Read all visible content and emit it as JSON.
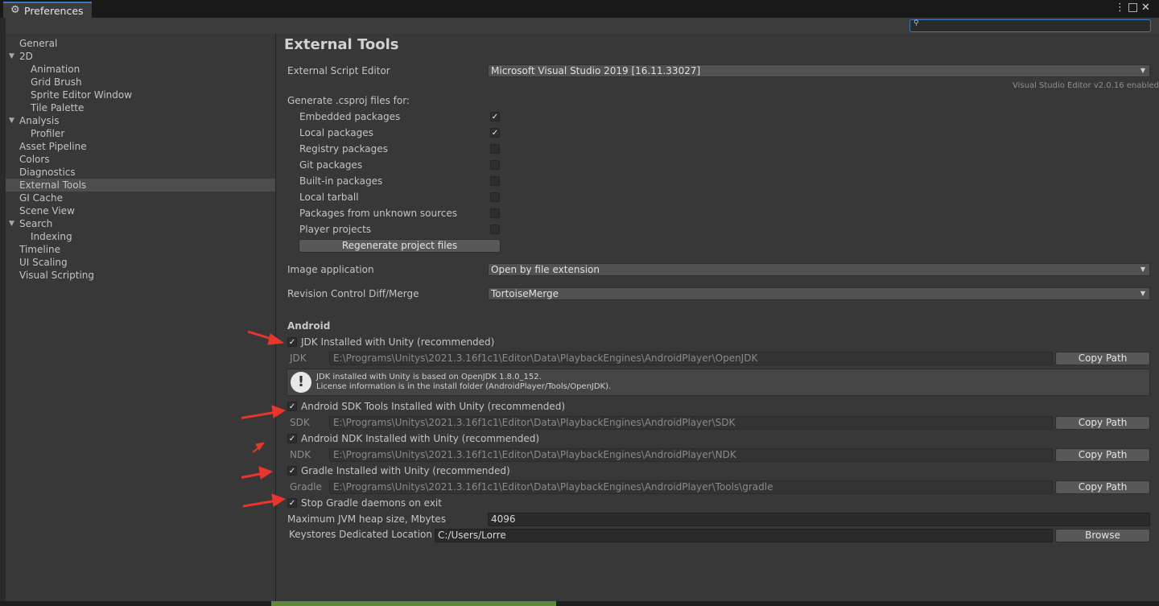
{
  "window": {
    "tab_title": "Preferences",
    "gear_icon": "gear-icon",
    "menu_icon": "⋮",
    "maximize_icon": "□",
    "close_icon": "✕"
  },
  "search": {
    "placeholder": "",
    "value": ""
  },
  "sidebar": {
    "items": [
      {
        "label": "General",
        "level": 0,
        "expanded": null,
        "selected": false
      },
      {
        "label": "2D",
        "level": 0,
        "expanded": true,
        "selected": false
      },
      {
        "label": "Animation",
        "level": 1,
        "expanded": null,
        "selected": false
      },
      {
        "label": "Grid Brush",
        "level": 1,
        "expanded": null,
        "selected": false
      },
      {
        "label": "Sprite Editor Window",
        "level": 1,
        "expanded": null,
        "selected": false
      },
      {
        "label": "Tile Palette",
        "level": 1,
        "expanded": null,
        "selected": false
      },
      {
        "label": "Analysis",
        "level": 0,
        "expanded": true,
        "selected": false
      },
      {
        "label": "Profiler",
        "level": 1,
        "expanded": null,
        "selected": false
      },
      {
        "label": "Asset Pipeline",
        "level": 0,
        "expanded": null,
        "selected": false
      },
      {
        "label": "Colors",
        "level": 0,
        "expanded": null,
        "selected": false
      },
      {
        "label": "Diagnostics",
        "level": 0,
        "expanded": null,
        "selected": false
      },
      {
        "label": "External Tools",
        "level": 0,
        "expanded": null,
        "selected": true
      },
      {
        "label": "GI Cache",
        "level": 0,
        "expanded": null,
        "selected": false
      },
      {
        "label": "Scene View",
        "level": 0,
        "expanded": null,
        "selected": false
      },
      {
        "label": "Search",
        "level": 0,
        "expanded": true,
        "selected": false
      },
      {
        "label": "Indexing",
        "level": 1,
        "expanded": null,
        "selected": false
      },
      {
        "label": "Timeline",
        "level": 0,
        "expanded": null,
        "selected": false
      },
      {
        "label": "UI Scaling",
        "level": 0,
        "expanded": null,
        "selected": false
      },
      {
        "label": "Visual Scripting",
        "level": 0,
        "expanded": null,
        "selected": false
      }
    ]
  },
  "main": {
    "title": "External Tools",
    "script_editor": {
      "label": "External Script Editor",
      "value": "Microsoft Visual Studio 2019 [16.11.33027]",
      "note": "Visual Studio Editor v2.0.16 enabled"
    },
    "csproj": {
      "label": "Generate .csproj files for:",
      "options": [
        {
          "label": "Embedded packages",
          "checked": true
        },
        {
          "label": "Local packages",
          "checked": true
        },
        {
          "label": "Registry packages",
          "checked": false
        },
        {
          "label": "Git packages",
          "checked": false
        },
        {
          "label": "Built-in packages",
          "checked": false
        },
        {
          "label": "Local tarball",
          "checked": false
        },
        {
          "label": "Packages from unknown sources",
          "checked": false
        },
        {
          "label": "Player projects",
          "checked": false
        }
      ],
      "regenerate_label": "Regenerate project files"
    },
    "image_app": {
      "label": "Image application",
      "value": "Open by file extension"
    },
    "revision": {
      "label": "Revision Control Diff/Merge",
      "value": "TortoiseMerge"
    },
    "android": {
      "header": "Android",
      "jdk": {
        "toggle_label": "JDK Installed with Unity (recommended)",
        "checked": true,
        "field_label": "JDK",
        "path": "E:\\Programs\\Unitys\\2021.3.16f1c1\\Editor\\Data\\PlaybackEngines\\AndroidPlayer\\OpenJDK",
        "copy_label": "Copy Path",
        "help_line1": "JDK installed with Unity is based on OpenJDK 1.8.0_152.",
        "help_line2": "License information is in the install folder (AndroidPlayer/Tools/OpenJDK).",
        "help_icon": "!"
      },
      "sdk": {
        "toggle_label": "Android SDK Tools Installed with Unity (recommended)",
        "checked": true,
        "field_label": "SDK",
        "path": "E:\\Programs\\Unitys\\2021.3.16f1c1\\Editor\\Data\\PlaybackEngines\\AndroidPlayer\\SDK",
        "copy_label": "Copy Path"
      },
      "ndk": {
        "toggle_label": "Android NDK Installed with Unity (recommended)",
        "checked": true,
        "field_label": "NDK",
        "path": "E:\\Programs\\Unitys\\2021.3.16f1c1\\Editor\\Data\\PlaybackEngines\\AndroidPlayer\\NDK",
        "copy_label": "Copy Path"
      },
      "gradle": {
        "toggle_label": "Gradle Installed with Unity (recommended)",
        "checked": true,
        "field_label": "Gradle",
        "path": "E:\\Programs\\Unitys\\2021.3.16f1c1\\Editor\\Data\\PlaybackEngines\\AndroidPlayer\\Tools\\gradle",
        "copy_label": "Copy Path"
      },
      "stop_gradle": {
        "label": "Stop Gradle daemons on exit",
        "checked": true
      },
      "jvm_heap": {
        "label": "Maximum JVM heap size, Mbytes",
        "value": "4096"
      },
      "keystores": {
        "label": "Keystores Dedicated Location",
        "value": "C:/Users/Lorre",
        "browse_label": "Browse"
      }
    }
  },
  "colors": {
    "accent": "#3a79bb",
    "annotation_arrow": "#e8362d"
  },
  "check_glyph": "✓",
  "dropdown_arrow": "▼",
  "expand_arrow": "▼",
  "search_glyph": "🔍"
}
